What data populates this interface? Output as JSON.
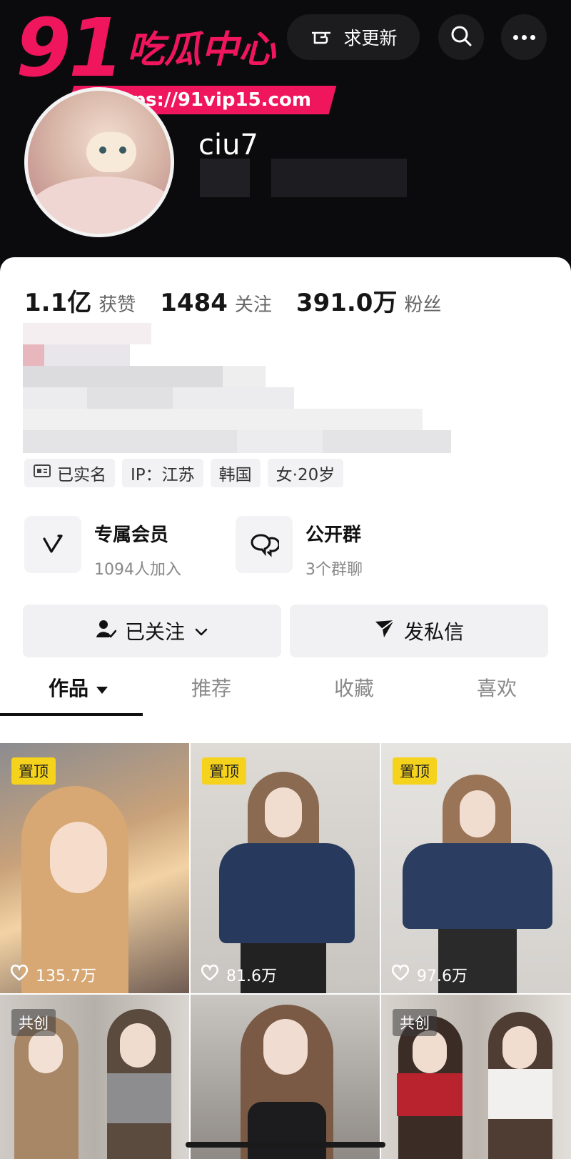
{
  "watermark": {
    "number": "91",
    "title": "吃瓜中心",
    "url": "https://91vip15.com"
  },
  "topbar": {
    "update_label": "求更新"
  },
  "profile": {
    "username": "ciu7"
  },
  "stats": [
    {
      "value": "1.1亿",
      "label": "获赞"
    },
    {
      "value": "1484",
      "label": "关注"
    },
    {
      "value": "391.0万",
      "label": "粉丝"
    }
  ],
  "tags": [
    {
      "label": "已实名",
      "icon": "id-card-icon"
    },
    {
      "label": "IP：江苏"
    },
    {
      "label": "韩国"
    },
    {
      "label": "女·20岁"
    }
  ],
  "features": [
    {
      "title": "专属会员",
      "subtitle": "1094人加入",
      "icon": "vip-v-icon"
    },
    {
      "title": "公开群",
      "subtitle": "3个群聊",
      "icon": "chat-bubbles-icon"
    }
  ],
  "actions": {
    "follow_label": "已关注",
    "message_label": "发私信"
  },
  "tabs": [
    {
      "label": "作品"
    },
    {
      "label": "推荐"
    },
    {
      "label": "收藏"
    },
    {
      "label": "喜欢"
    }
  ],
  "videos": [
    {
      "badge": "置顶",
      "likes": "135.7万"
    },
    {
      "badge": "置顶",
      "likes": "81.6万"
    },
    {
      "badge": "置顶",
      "likes": "97.6万"
    },
    {
      "badge": "共创"
    },
    {
      "badge": ""
    },
    {
      "badge": "共创"
    }
  ],
  "colors": {
    "brand_pink": "#f0165d",
    "pin_yellow": "#f5d21c",
    "header_bg": "#0b0b0d"
  }
}
